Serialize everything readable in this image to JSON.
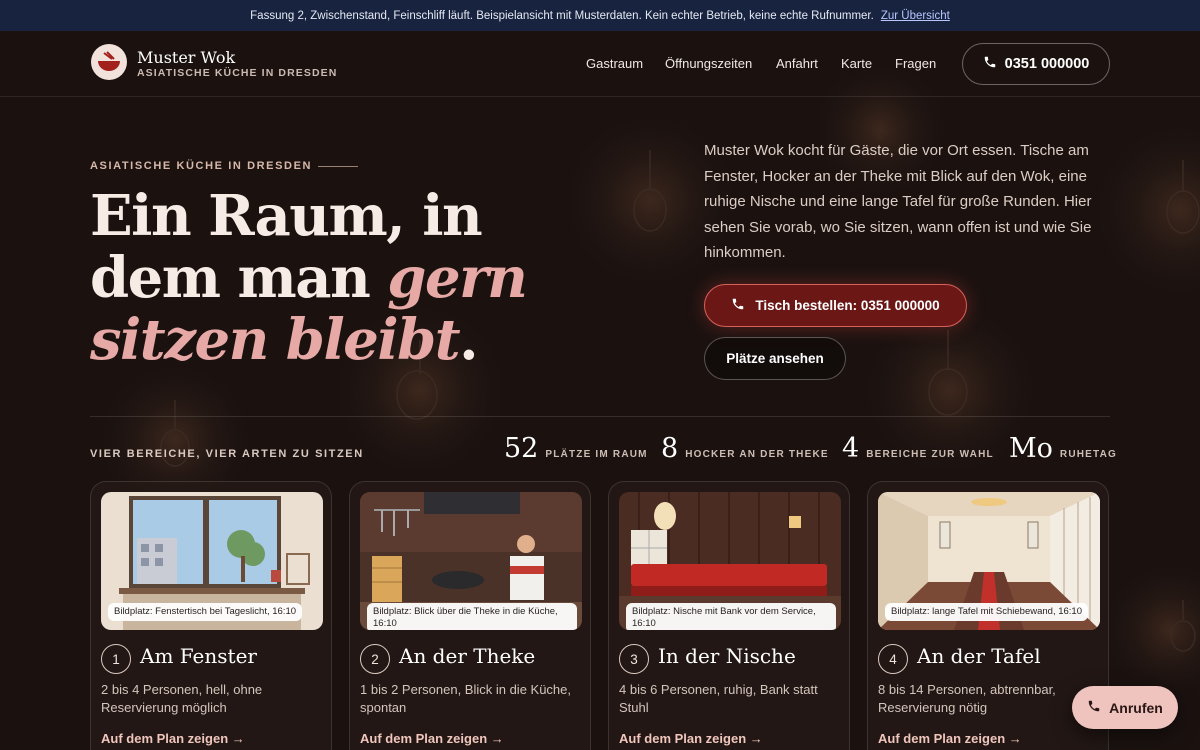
{
  "banner": {
    "text": "Fassung 2, Zwischenstand, Feinschliff läuft. Beispielansicht mit Musterdaten. Kein echter Betrieb, keine echte Rufnummer.",
    "link": "Zur Übersicht"
  },
  "nav": {
    "brand": "Muster Wok",
    "subtitle": "ASIATISCHE KÜCHE IN DRESDEN",
    "links": [
      "Gastraum",
      "Öffnungszeiten",
      "Anfahrt",
      "Karte",
      "Fragen"
    ],
    "phone": "0351 000000"
  },
  "hero": {
    "kicker": "ASIATISCHE KÜCHE IN DRESDEN",
    "headline_line1": "Ein Raum, in",
    "headline_line2": "dem man ",
    "headline_em1": "gern",
    "headline_em2": "sitzen bleibt",
    "headline_dot": ".",
    "intro": "Muster Wok kocht für Gäste, die vor Ort essen. Tische am Fenster, Hocker an der Theke mit Blick auf den Wok, eine ruhige Nische und eine lange Tafel für große Runden. Hier sehen Sie vorab, wo Sie sitzen, wann offen ist und wie Sie hinkommen.",
    "primary_button": "Tisch bestellen: 0351 000000",
    "secondary_button": "Plätze ansehen"
  },
  "areas": {
    "label": "VIER BEREICHE, VIER ARTEN ZU SITZEN",
    "stats": [
      {
        "num": "52",
        "label": "PLÄTZE IM RAUM"
      },
      {
        "num": "8",
        "label": "HOCKER AN DER THEKE"
      },
      {
        "num": "4",
        "label": "BEREICHE ZUR WAHL"
      },
      {
        "num": "Mo",
        "label": "RUHETAG"
      }
    ],
    "cards": [
      {
        "num": "1",
        "title": "Am Fenster",
        "desc": "2 bis 4 Personen, hell, ohne Reservierung möglich",
        "caption": "Bildplatz: Fenstertisch bei Tageslicht, 16:10",
        "link": "Auf dem Plan zeigen"
      },
      {
        "num": "2",
        "title": "An der Theke",
        "desc": "1 bis 2 Personen, Blick in die Küche, spontan",
        "caption": "Bildplatz: Blick über die Theke in die Küche, 16:10",
        "link": "Auf dem Plan zeigen"
      },
      {
        "num": "3",
        "title": "In der Nische",
        "desc": "4 bis 6 Personen, ruhig, Bank statt Stuhl",
        "caption": "Bildplatz: Nische mit Bank vor dem Service, 16:10",
        "link": "Auf dem Plan zeigen"
      },
      {
        "num": "4",
        "title": "An der Tafel",
        "desc": "8 bis 14 Personen, abtrennbar, Reservierung nötig",
        "caption": "Bildplatz: lange Tafel mit Schiebewand, 16:10",
        "link": "Auf dem Plan zeigen"
      }
    ]
  },
  "call_button": "Anrufen",
  "colors": {
    "background": "#1b1210",
    "banner": "#17233f",
    "accent_pink": "#e6a9a6",
    "primary_button": "#6b1716",
    "call_button": "#efc4be"
  }
}
